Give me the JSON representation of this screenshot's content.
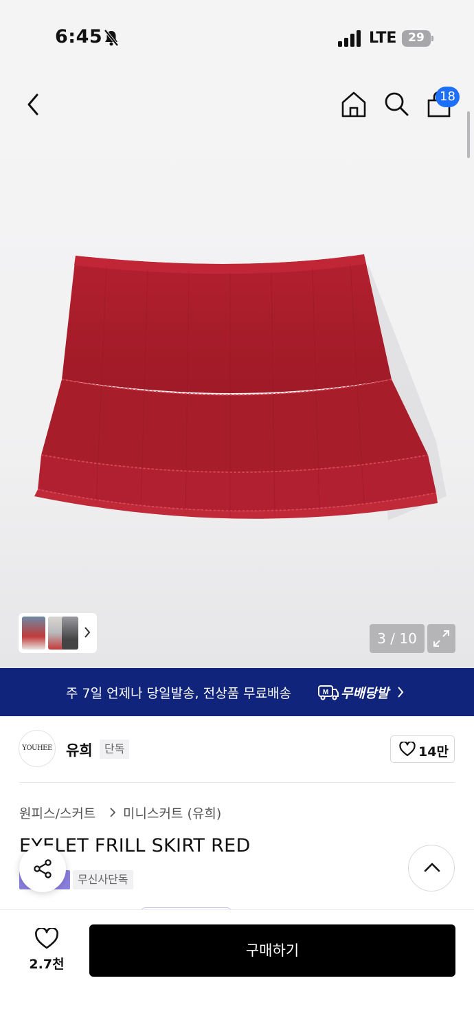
{
  "status_bar": {
    "time": "6:45",
    "network": "LTE",
    "battery": "29",
    "icons": [
      "bell-slash-icon",
      "signal-icon",
      "battery-icon"
    ]
  },
  "nav": {
    "icons": [
      "back-icon",
      "home-icon",
      "search-icon",
      "shopping-bag-icon"
    ],
    "cart_count": "18"
  },
  "gallery": {
    "counter": "3 / 10",
    "skirt_color": "#b01f2c"
  },
  "promo": {
    "text": "주 7일 언제나 당일발송, 전상품 무료배송",
    "brand": "무배당발"
  },
  "brand": {
    "logo_text": "YOUHEE",
    "name": "유희",
    "tag": "단독",
    "follow_count": "14만"
  },
  "product": {
    "category": "원피스/스커트",
    "subcategory": "미니스커트 (유희)",
    "title": "EYELET FRILL SKIRT RED",
    "tag": "무신사단독"
  },
  "bottom_bar": {
    "like_count": "2.7천",
    "buy_label": "구매하기"
  },
  "colors": {
    "accent_blue": "#1e6ff7",
    "promo_navy": "#11247b",
    "tag_purple": "#8b7fde"
  }
}
